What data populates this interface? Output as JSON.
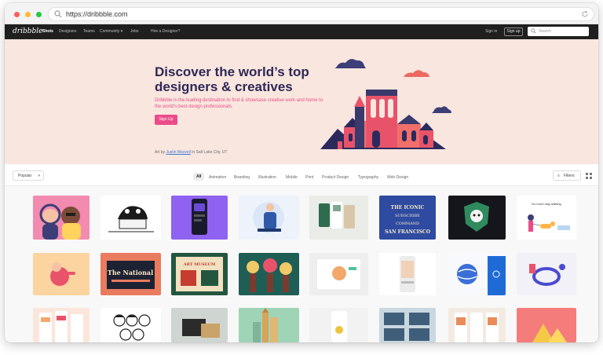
{
  "browser": {
    "url": "https://dribbble.com",
    "icons": {
      "url": "search-icon",
      "reload": "reload-icon"
    }
  },
  "nav": {
    "logo": "dribbble",
    "links": [
      "Shots",
      "Designers",
      "Teams",
      "Community",
      "Jobs",
      "Hire a Designer?"
    ],
    "signin": "Sign in",
    "signup": "Sign up",
    "search_placeholder": "Search"
  },
  "hero": {
    "title": "Discover the world’s top designers & creatives",
    "subtitle": "Dribbble is the leading destination to find & showcase creative work and home to the world's best design professionals.",
    "cta": "Sign Up",
    "credit_prefix": "Art by",
    "credit_author": "Justin Mezzell",
    "credit_suffix": "in Salt Lake City, UT"
  },
  "filters": {
    "sort_label": "Popular",
    "categories": [
      "All",
      "Animation",
      "Branding",
      "Illustration",
      "Mobile",
      "Print",
      "Product Design",
      "Typography",
      "Web Design"
    ],
    "filters_label": "Filters",
    "icons": {
      "sort": "chevron-down-icon",
      "filters": "filter-icon",
      "view": "grid-icon"
    }
  },
  "shots": {
    "row2_labels": [
      "The National",
      "ART MUSEUM",
      "THE ICONIC SAN FRANCISCO"
    ],
    "row1_labels": [
      "THE ICONIC SUBSCRIBE COMMAND SAN FRANCISCO",
      "Do more dog walking"
    ]
  },
  "colors": {
    "brand_pink": "#ea4c89",
    "hero_bg": "#f9e6df",
    "title_navy": "#2e2856",
    "nav_bg": "#1f1f1f"
  }
}
